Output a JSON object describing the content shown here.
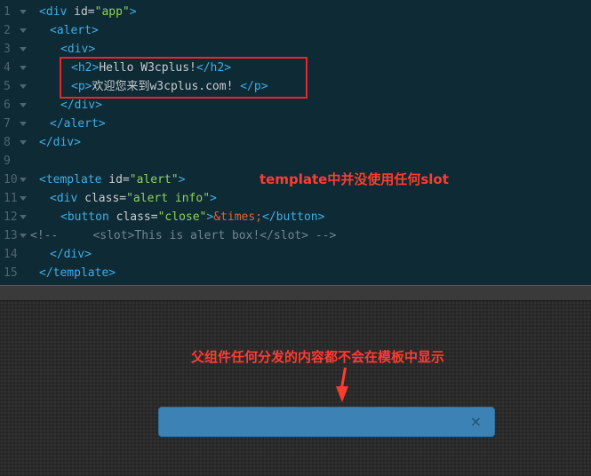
{
  "editor": {
    "lines": [
      {
        "num": "1",
        "fold": true,
        "indent": 0,
        "tokens": [
          [
            "b",
            "<"
          ],
          [
            "tag",
            "div"
          ],
          [
            "attr",
            " id="
          ],
          [
            "str",
            "\"app\""
          ],
          [
            "b",
            ">"
          ]
        ]
      },
      {
        "num": "2",
        "fold": true,
        "indent": 1,
        "tokens": [
          [
            "b",
            "<"
          ],
          [
            "tag",
            "alert"
          ],
          [
            "b",
            ">"
          ]
        ]
      },
      {
        "num": "3",
        "fold": true,
        "indent": 2,
        "tokens": [
          [
            "b",
            "<"
          ],
          [
            "tag",
            "div"
          ],
          [
            "b",
            ">"
          ]
        ]
      },
      {
        "num": "4",
        "fold": true,
        "indent": 3,
        "tokens": [
          [
            "b",
            "<"
          ],
          [
            "tag",
            "h2"
          ],
          [
            "b",
            ">"
          ],
          [
            "txt",
            "Hello W3cplus!"
          ],
          [
            "b",
            "</"
          ],
          [
            "tag",
            "h2"
          ],
          [
            "b",
            ">"
          ]
        ]
      },
      {
        "num": "5",
        "fold": true,
        "indent": 3,
        "tokens": [
          [
            "b",
            "<"
          ],
          [
            "tag",
            "p"
          ],
          [
            "b",
            ">"
          ],
          [
            "txt",
            "欢迎您来到w3cplus.com! "
          ],
          [
            "b",
            "</"
          ],
          [
            "tag",
            "p"
          ],
          [
            "b",
            ">"
          ]
        ]
      },
      {
        "num": "6",
        "fold": true,
        "indent": 2,
        "tokens": [
          [
            "b",
            "</"
          ],
          [
            "tag",
            "div"
          ],
          [
            "b",
            ">"
          ]
        ]
      },
      {
        "num": "7",
        "fold": true,
        "indent": 1,
        "tokens": [
          [
            "b",
            "</"
          ],
          [
            "tag",
            "alert"
          ],
          [
            "b",
            ">"
          ]
        ]
      },
      {
        "num": "8",
        "fold": true,
        "indent": 0,
        "tokens": [
          [
            "b",
            "</"
          ],
          [
            "tag",
            "div"
          ],
          [
            "b",
            ">"
          ]
        ]
      },
      {
        "num": "9",
        "fold": false,
        "indent": 0,
        "tokens": []
      },
      {
        "num": "10",
        "fold": true,
        "indent": 0,
        "tokens": [
          [
            "b",
            "<"
          ],
          [
            "tag",
            "template"
          ],
          [
            "attr",
            " id="
          ],
          [
            "str",
            "\"alert\""
          ],
          [
            "b",
            ">"
          ]
        ]
      },
      {
        "num": "11",
        "fold": true,
        "indent": 1,
        "tokens": [
          [
            "b",
            "<"
          ],
          [
            "tag",
            "div"
          ],
          [
            "attr",
            " class="
          ],
          [
            "str",
            "\"alert info\""
          ],
          [
            "b",
            ">"
          ]
        ]
      },
      {
        "num": "12",
        "fold": true,
        "indent": 2,
        "tokens": [
          [
            "b",
            "<"
          ],
          [
            "tag",
            "button"
          ],
          [
            "attr",
            " class="
          ],
          [
            "str",
            "\"close\""
          ],
          [
            "b",
            ">"
          ],
          [
            "ent",
            "&times;"
          ],
          [
            "b",
            "</"
          ],
          [
            "tag",
            "button"
          ],
          [
            "b",
            ">"
          ]
        ]
      },
      {
        "num": "13",
        "fold": true,
        "indent": -1,
        "tokens": [
          [
            "com",
            "<!--     <slot>This is alert box!</slot> -->"
          ]
        ]
      },
      {
        "num": "14",
        "fold": false,
        "indent": 1,
        "tokens": [
          [
            "b",
            "</"
          ],
          [
            "tag",
            "div"
          ],
          [
            "b",
            ">"
          ]
        ]
      },
      {
        "num": "15",
        "fold": false,
        "indent": 0,
        "tokens": [
          [
            "b",
            "</"
          ],
          [
            "tag",
            "template"
          ],
          [
            "b",
            ">"
          ]
        ]
      }
    ]
  },
  "annotations": {
    "top": "template中并没使用任何slot",
    "bottom": "父组件任何分发的内容都不会在模板中显示"
  },
  "preview": {
    "close_label": "×"
  },
  "colors": {
    "editor_bg": "#0e2a35",
    "highlight": "#e8262b",
    "annotation": "#ff3b30",
    "alert_bg": "#3d82b5"
  }
}
